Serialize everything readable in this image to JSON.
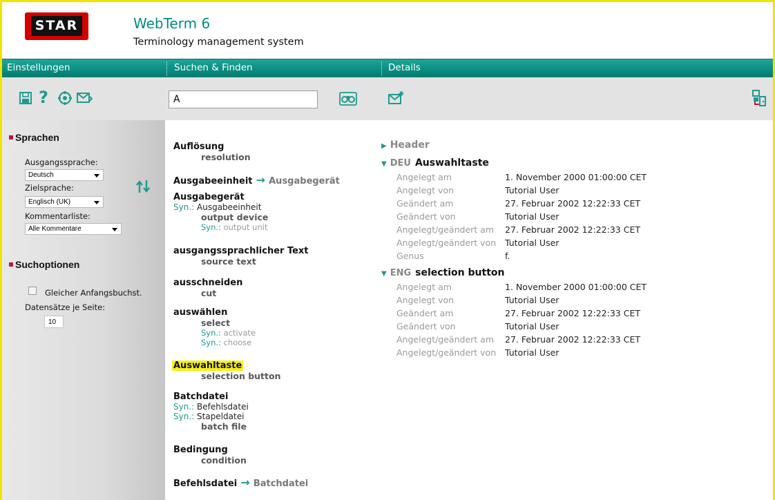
{
  "app": {
    "logo": "STAR",
    "title": "WebTerm 6",
    "subtitle": "Terminology management system"
  },
  "menubar": [
    "Einstellungen",
    "Suchen & Finden",
    "Details"
  ],
  "toolbar": {
    "left_icons": [
      "save-icon",
      "help-icon",
      "settings-icon",
      "mail-icon"
    ],
    "search_value": "A",
    "search_button_icon": "binoculars-icon",
    "details_icon": "new-mail-icon",
    "right_icon": "logout-icon"
  },
  "sidebar": {
    "languages_heading": "Sprachen",
    "source_label": "Ausgangssprache:",
    "source_value": "Deutsch",
    "target_label": "Zielsprache:",
    "target_value": "Englisch (UK)",
    "comment_label": "Kommentarliste:",
    "comment_value": "Alle Kommentare",
    "swap_icon": "swap-languages-icon",
    "search_heading": "Suchoptionen",
    "same_initial_label": "Gleicher Anfangsbuchst.",
    "records_label": "Datensätze je Seite:",
    "records_value": "10"
  },
  "results": [
    {
      "term": "Auflösung",
      "translation": "resolution"
    },
    {
      "term": "Ausgabeeinheit",
      "ref": "Ausgabegerät"
    },
    {
      "term": "Ausgabegerät",
      "syn_label": "Syn.:",
      "syn": "Ausgabeeinheit",
      "translation": "output device",
      "trans_syn": [
        "output unit"
      ]
    },
    {
      "term": "ausgangssprachlicher Text",
      "translation": "source text"
    },
    {
      "term": "ausschneiden",
      "translation": "cut"
    },
    {
      "term": "auswählen",
      "translation": "select",
      "trans_syn": [
        "activate",
        "choose"
      ]
    },
    {
      "term": "Auswahltaste",
      "translation": "selection button",
      "highlighted": true
    },
    {
      "term": "Batchdatei",
      "syns": [
        "Befehlsdatei",
        "Stapeldatei"
      ],
      "translation": "batch file"
    },
    {
      "term": "Bedingung",
      "translation": "condition"
    },
    {
      "term": "Befehlsdatei",
      "ref": "Batchdatei"
    }
  ],
  "details": {
    "header_label": "Header",
    "sections": [
      {
        "lang": "DEU",
        "term": "Auswahltaste",
        "rows": [
          [
            "Angelegt am",
            "1. November 2000 01:00:00 CET"
          ],
          [
            "Angelegt von",
            "Tutorial User"
          ],
          [
            "Geändert am",
            "27. Februar 2002 12:22:33 CET"
          ],
          [
            "Geändert von",
            "Tutorial User"
          ],
          [
            "Angelegt/geändert am",
            "27. Februar 2002 12:22:33 CET"
          ],
          [
            "Angelegt/geändert von",
            "Tutorial User"
          ],
          [
            "Genus",
            "f."
          ]
        ]
      },
      {
        "lang": "ENG",
        "term": "selection button",
        "rows": [
          [
            "Angelegt am",
            "1. November 2000 01:00:00 CET"
          ],
          [
            "Angelegt von",
            "Tutorial User"
          ],
          [
            "Geändert am",
            "27. Februar 2002 12:22:33 CET"
          ],
          [
            "Geändert von",
            "Tutorial User"
          ],
          [
            "Angelegt/geändert am",
            "27. Februar 2002 12:22:33 CET"
          ],
          [
            "Angelegt/geändert von",
            "Tutorial User"
          ]
        ]
      }
    ]
  },
  "colors": {
    "accent": "#1e9a8f",
    "menubar": "#008c82",
    "highlight": "#f6ef1c",
    "frame": "#f2e300"
  }
}
